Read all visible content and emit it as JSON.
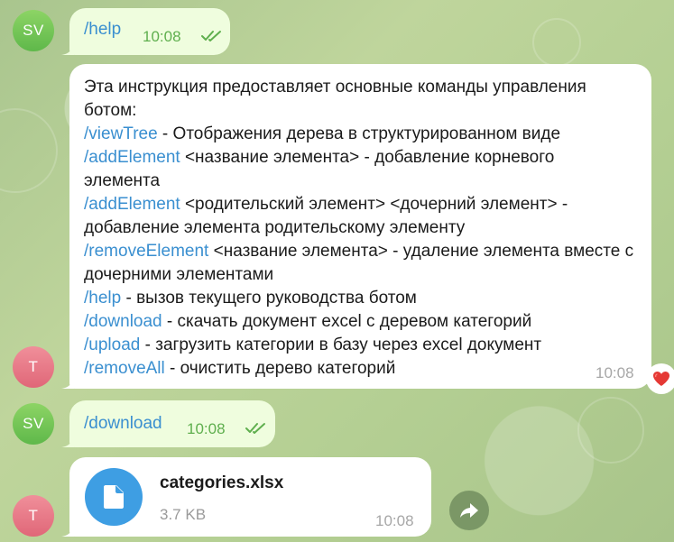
{
  "messages": {
    "m1": {
      "avatar": "SV",
      "text": "/help",
      "time": "10:08"
    },
    "m2": {
      "avatar": "T",
      "intro": "Эта инструкция предоставляет основные команды управления ботом:",
      "lines": [
        {
          "cmd": "/viewTree",
          "desc": " - Отображения дерева в структурированном виде"
        },
        {
          "cmd": "/addElement",
          "desc": " <название элемента> - добавление корневого элемента"
        },
        {
          "cmd": "/addElement",
          "desc": " <родительский элемент> <дочерний элемент> - добавление элемента родительскому элементу"
        },
        {
          "cmd": "/removeElement",
          "desc": " <название элемента> - удаление элемента вместе с дочерними элементами"
        },
        {
          "cmd": "/help",
          "desc": " - вызов текущего руководства ботом"
        },
        {
          "cmd": "/download",
          "desc": " - скачать документ excel с деревом категорий"
        },
        {
          "cmd": "/upload",
          "desc": " - загрузить категории в базу через excel документ"
        },
        {
          "cmd": "/removeAll",
          "desc": " - очистить дерево категорий"
        }
      ],
      "time": "10:08",
      "reaction": "heart"
    },
    "m3": {
      "avatar": "SV",
      "text": "/download",
      "time": "10:08"
    },
    "m4": {
      "avatar": "T",
      "file_name": "categories.xlsx",
      "file_size": "3.7 KB",
      "time": "10:08"
    }
  },
  "colors": {
    "outgoing_bubble": "#effdde",
    "incoming_bubble": "#ffffff",
    "command_link": "#3a8fd0",
    "file_icon": "#3e9ee3"
  },
  "icons": [
    "double-check-icon",
    "heart-icon",
    "document-icon",
    "forward-icon"
  ]
}
